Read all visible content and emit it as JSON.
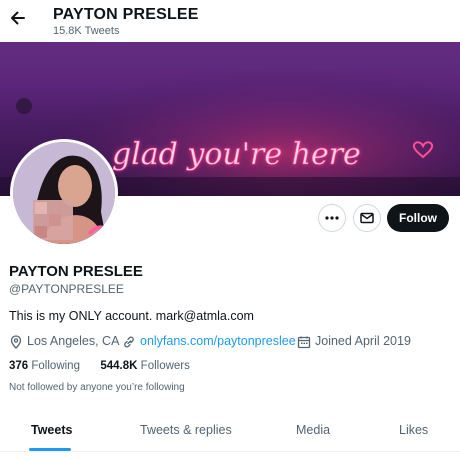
{
  "header": {
    "name": "PAYTON PRESLEE",
    "tweet_count": "15.8K Tweets",
    "back_icon": "arrow-left-icon"
  },
  "banner": {
    "neon_text": "glad you're here",
    "neon_color": "#ff3d8b"
  },
  "actions": {
    "more_icon": "ellipsis-icon",
    "message_icon": "envelope-icon",
    "follow_label": "Follow"
  },
  "profile": {
    "display_name": "PAYTON PRESLEE",
    "handle": "@PAYTONPRESLEE",
    "bio": "This is my ONLY account.  mark@atmla.com",
    "location": "Los Angeles, CA",
    "website": "onlyfans.com/paytonpreslee",
    "joined": "Joined April 2019",
    "following_count": "376",
    "following_label": "Following",
    "followers_count": "544.8K",
    "followers_label": "Followers",
    "not_followed": "Not followed by anyone you’re following"
  },
  "tabs": [
    {
      "label": "Tweets",
      "active": true
    },
    {
      "label": "Tweets & replies",
      "active": false
    },
    {
      "label": "Media",
      "active": false
    },
    {
      "label": "Likes",
      "active": false
    }
  ],
  "colors": {
    "accent": "#1d9bf0",
    "text_primary": "#0f1419",
    "text_secondary": "#536471",
    "follow_button_bg": "#0f1419"
  }
}
